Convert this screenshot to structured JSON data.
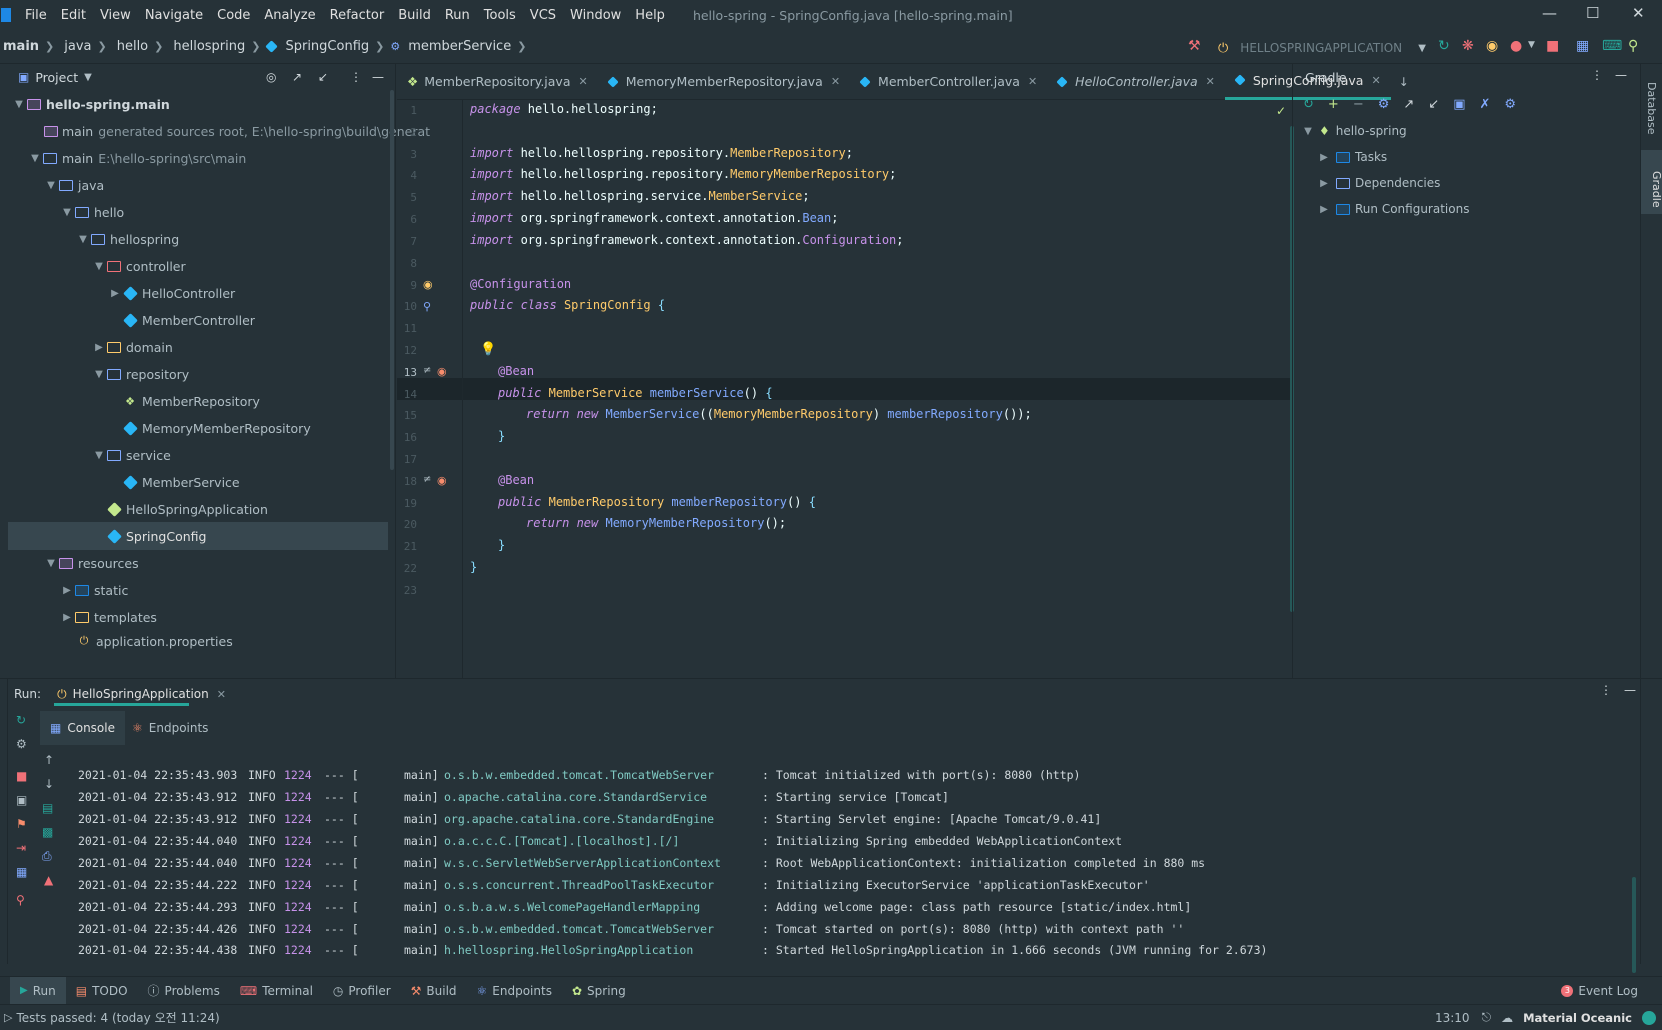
{
  "menubar": {
    "items": [
      "File",
      "Edit",
      "View",
      "Navigate",
      "Code",
      "Analyze",
      "Refactor",
      "Build",
      "Run",
      "Tools",
      "VCS",
      "Window",
      "Help"
    ],
    "title": "hello-spring - SpringConfig.java [hello-spring.main]"
  },
  "breadcrumb": [
    "main",
    "java",
    "hello",
    "hellospring",
    "SpringConfig",
    "memberService"
  ],
  "run_config": "HELLOSPRINGAPPLICATION",
  "project": {
    "header": "Project",
    "rows": [
      {
        "label": "hello-spring.main",
        "extra": ""
      },
      {
        "label": "main",
        "extra": "generated sources root,  E:\\hello-spring\\build\\generat"
      },
      {
        "label": "main",
        "extra": "E:\\hello-spring\\src\\main"
      },
      {
        "label": "java",
        "extra": ""
      },
      {
        "label": "hello",
        "extra": ""
      },
      {
        "label": "hellospring",
        "extra": ""
      },
      {
        "label": "controller",
        "extra": ""
      },
      {
        "label": "HelloController",
        "extra": ""
      },
      {
        "label": "MemberController",
        "extra": ""
      },
      {
        "label": "domain",
        "extra": ""
      },
      {
        "label": "repository",
        "extra": ""
      },
      {
        "label": "MemberRepository",
        "extra": ""
      },
      {
        "label": "MemoryMemberRepository",
        "extra": ""
      },
      {
        "label": "service",
        "extra": ""
      },
      {
        "label": "MemberService",
        "extra": ""
      },
      {
        "label": "HelloSpringApplication",
        "extra": ""
      },
      {
        "label": "SpringConfig",
        "extra": ""
      },
      {
        "label": "resources",
        "extra": ""
      },
      {
        "label": "static",
        "extra": ""
      },
      {
        "label": "templates",
        "extra": ""
      },
      {
        "label": "application.properties",
        "extra": ""
      }
    ]
  },
  "editor": {
    "tabs": [
      "MemberRepository.java",
      "MemoryMemberRepository.java",
      "MemberController.java",
      "HelloController.java",
      "SpringConfig.java"
    ],
    "line_numbers": [
      "1",
      "2",
      "3",
      "4",
      "5",
      "6",
      "7",
      "8",
      "9",
      "10",
      "11",
      "12",
      "13",
      "14",
      "15",
      "16",
      "17",
      "18",
      "19",
      "20",
      "21",
      "22",
      "23"
    ]
  },
  "gradle": {
    "header": "Gradle",
    "root": "hello-spring",
    "items": [
      "Tasks",
      "Dependencies",
      "Run Configurations"
    ]
  },
  "run": {
    "label": "Run:",
    "tab": "HelloSpringApplication",
    "subtabs": [
      "Console",
      "Endpoints"
    ],
    "logs": [
      {
        "ts": "2021-01-04 22:35:43.903",
        "lvl": "INFO",
        "pid": "1224",
        "sep": "--- [",
        "thread": "main]",
        "logger": "o.s.b.w.embedded.tomcat.TomcatWebServer",
        "msg": ": Tomcat initialized with port(s): 8080 (http)"
      },
      {
        "ts": "2021-01-04 22:35:43.912",
        "lvl": "INFO",
        "pid": "1224",
        "sep": "--- [",
        "thread": "main]",
        "logger": "o.apache.catalina.core.StandardService",
        "msg": ": Starting service [Tomcat]"
      },
      {
        "ts": "2021-01-04 22:35:43.912",
        "lvl": "INFO",
        "pid": "1224",
        "sep": "--- [",
        "thread": "main]",
        "logger": "org.apache.catalina.core.StandardEngine",
        "msg": ": Starting Servlet engine: [Apache Tomcat/9.0.41]"
      },
      {
        "ts": "2021-01-04 22:35:44.040",
        "lvl": "INFO",
        "pid": "1224",
        "sep": "--- [",
        "thread": "main]",
        "logger": "o.a.c.c.C.[Tomcat].[localhost].[/]",
        "msg": ": Initializing Spring embedded WebApplicationContext"
      },
      {
        "ts": "2021-01-04 22:35:44.040",
        "lvl": "INFO",
        "pid": "1224",
        "sep": "--- [",
        "thread": "main]",
        "logger": "w.s.c.ServletWebServerApplicationContext",
        "msg": ": Root WebApplicationContext: initialization completed in 880 ms"
      },
      {
        "ts": "2021-01-04 22:35:44.222",
        "lvl": "INFO",
        "pid": "1224",
        "sep": "--- [",
        "thread": "main]",
        "logger": "o.s.s.concurrent.ThreadPoolTaskExecutor",
        "msg": ": Initializing ExecutorService 'applicationTaskExecutor'"
      },
      {
        "ts": "2021-01-04 22:35:44.293",
        "lvl": "INFO",
        "pid": "1224",
        "sep": "--- [",
        "thread": "main]",
        "logger": "o.s.b.a.w.s.WelcomePageHandlerMapping",
        "msg": ": Adding welcome page: class path resource [static/index.html]"
      },
      {
        "ts": "2021-01-04 22:35:44.426",
        "lvl": "INFO",
        "pid": "1224",
        "sep": "--- [",
        "thread": "main]",
        "logger": "o.s.b.w.embedded.tomcat.TomcatWebServer",
        "msg": ": Tomcat started on port(s): 8080 (http) with context path ''"
      },
      {
        "ts": "2021-01-04 22:35:44.438",
        "lvl": "INFO",
        "pid": "1224",
        "sep": "--- [",
        "thread": "main]",
        "logger": "h.hellospring.HelloSpringApplication",
        "msg": ": Started HelloSpringApplication in 1.666 seconds (JVM running for 2.673)"
      }
    ]
  },
  "bottom_tools": [
    "Run",
    "TODO",
    "Problems",
    "Terminal",
    "Profiler",
    "Build",
    "Endpoints",
    "Spring"
  ],
  "event_log": {
    "count": "3",
    "label": "Event Log"
  },
  "status": {
    "tests": "Tests passed: 4 (today 오전 11:24)",
    "position": "13:10",
    "theme": "Material Oceanic"
  },
  "right_strip": [
    "Database",
    "Gradle"
  ],
  "colors": {
    "bg": "#263238",
    "accent": "#26a69a",
    "selection": "#37474f"
  }
}
